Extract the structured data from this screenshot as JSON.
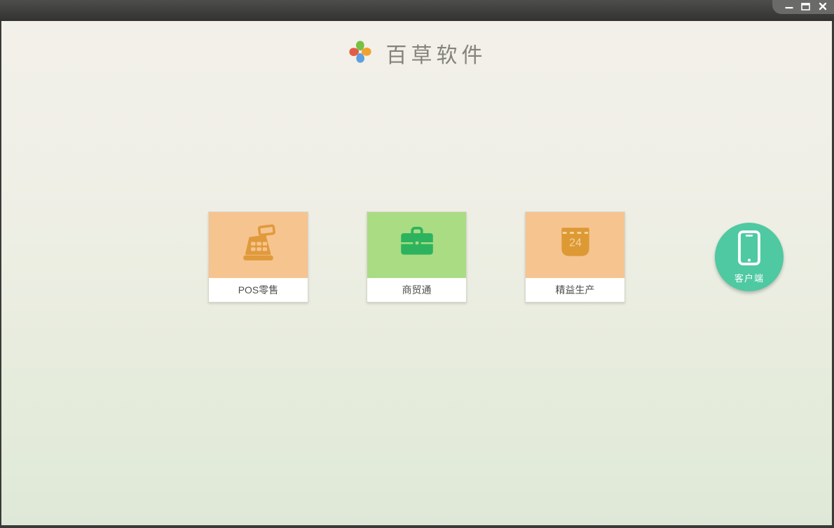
{
  "window": {
    "controls": [
      {
        "name": "minimize",
        "icon": "minimize-icon"
      },
      {
        "name": "maximize",
        "icon": "maximize-icon"
      },
      {
        "name": "close",
        "icon": "close-icon"
      }
    ]
  },
  "header": {
    "app_title": "百草软件",
    "logo_icon": "pinwheel-logo"
  },
  "products": [
    {
      "label": "POS零售",
      "icon": "cash-register-icon",
      "card_color": "#f6c48f",
      "icon_color": "#e09a3c"
    },
    {
      "label": "商贸通",
      "icon": "briefcase-icon",
      "card_color": "#aadc83",
      "icon_color": "#2db35d"
    },
    {
      "label": "精益生产",
      "icon": "calendar-icon",
      "card_color": "#f6c48f",
      "icon_color": "#dd9934",
      "calendar_day": "24"
    }
  ],
  "client_button": {
    "label": "客户端",
    "icon": "smartphone-icon",
    "color": "#4fc9a1"
  },
  "colors": {
    "titlebar_top": "#4d4d4b",
    "titlebar_bottom": "#323230",
    "controls_tab": "#6a6a68",
    "background_top": "#f2f0e9",
    "background_bottom": "#dfe8d8",
    "card_label_text": "#4e4e4e",
    "app_title_text": "#83837b"
  }
}
